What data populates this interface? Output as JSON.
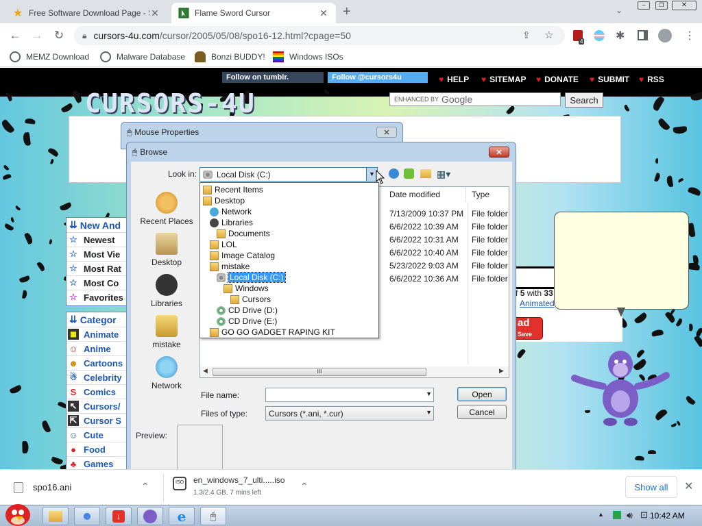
{
  "browser": {
    "tabs": [
      {
        "title": "Free Software Download Page - S",
        "active": false
      },
      {
        "title": "Flame Sword Cursor",
        "active": true
      }
    ],
    "new_tab_symbol": "+",
    "url_host": "cursors-4u.com",
    "url_path": "/cursor/2005/05/08/spo16-12.html?cpage=50",
    "bookmarks": [
      "MEMZ Download",
      "Malware Database",
      "Bonzi BUDDY!",
      "Windows ISOs"
    ],
    "extension_badge": "4"
  },
  "site": {
    "logo": "CURSORS-4U",
    "tumblr": "Follow on tumblr.",
    "twitter": "Follow @cursors4u",
    "nav": [
      "HELP",
      "SITEMAP",
      "DONATE",
      "SUBMIT",
      "RSS"
    ],
    "search_label": "ENHANCED BY",
    "search_brand": "Google",
    "search_button": "Search",
    "new_header": "New And",
    "new_items": [
      "Newest",
      "Most Vie",
      "Most Rat",
      "Most Co",
      "Favorites"
    ],
    "cat_header": "Categor",
    "categories": [
      "Animate",
      "Anime",
      "Cartoons",
      "Celebrity",
      "Comics",
      "Cursors/",
      "Cursor S",
      "Cute",
      "Food",
      "Games"
    ],
    "page_info_prefix": "f",
    "page_info_bold1": "5",
    "page_info_mid": "with",
    "page_info_bold2": "33",
    "animated_link": "Animated",
    "dl_big": "ad",
    "dl_small": "Save"
  },
  "mouse_props": {
    "title": "Mouse Properties"
  },
  "browse": {
    "title": "Browse",
    "look_in_label": "Look in:",
    "look_in_value": "Local Disk (C:)",
    "places": [
      "Recent Places",
      "Desktop",
      "Libraries",
      "mistake",
      "Network"
    ],
    "dropdown": [
      {
        "label": "Recent Items",
        "icon": "recent",
        "indent": 0
      },
      {
        "label": "Desktop",
        "icon": "desktop",
        "indent": 0
      },
      {
        "label": "Network",
        "icon": "network",
        "indent": 1
      },
      {
        "label": "Libraries",
        "icon": "libraries",
        "indent": 1
      },
      {
        "label": "Documents",
        "icon": "folder",
        "indent": 2
      },
      {
        "label": "LOL",
        "icon": "folder",
        "indent": 1
      },
      {
        "label": "Image Catalog",
        "icon": "image",
        "indent": 1
      },
      {
        "label": "mistake",
        "icon": "user",
        "indent": 1
      },
      {
        "label": "Local Disk (C:)",
        "icon": "disk",
        "indent": 2,
        "selected": true
      },
      {
        "label": "Windows",
        "icon": "folder",
        "indent": 3
      },
      {
        "label": "Cursors",
        "icon": "folder",
        "indent": 4
      },
      {
        "label": "CD Drive (D:)",
        "icon": "cd",
        "indent": 2
      },
      {
        "label": "CD Drive (E:)",
        "icon": "cd",
        "indent": 2
      },
      {
        "label": "GO GO GADGET RAPING KIT",
        "icon": "box",
        "indent": 1
      }
    ],
    "columns": [
      "Date modified",
      "Type"
    ],
    "rows": [
      {
        "date": "7/13/2009 10:37 PM",
        "type": "File folder"
      },
      {
        "date": "6/6/2022 10:39 AM",
        "type": "File folder"
      },
      {
        "date": "6/6/2022 10:31 AM",
        "type": "File folder"
      },
      {
        "date": "6/6/2022 10:40 AM",
        "type": "File folder"
      },
      {
        "date": "5/23/2022 9:03 AM",
        "type": "File folder"
      },
      {
        "date": "6/6/2022 10:36 AM",
        "type": "File folder"
      }
    ],
    "scroll_thumb": "III",
    "file_name_label": "File name:",
    "file_name_value": "",
    "file_type_label": "Files of type:",
    "file_type_value": "Cursors (*.ani, *.cur)",
    "open_button": "Open",
    "cancel_button": "Cancel",
    "preview_label": "Preview:"
  },
  "download_bar": {
    "item1_name": "spo16.ani",
    "item2_name": "en_windows_7_ulti.....iso",
    "item2_status": "1.3/2.4 GB, 7 mins left",
    "show_all": "Show all"
  },
  "taskbar": {
    "time": "10:42 AM"
  }
}
